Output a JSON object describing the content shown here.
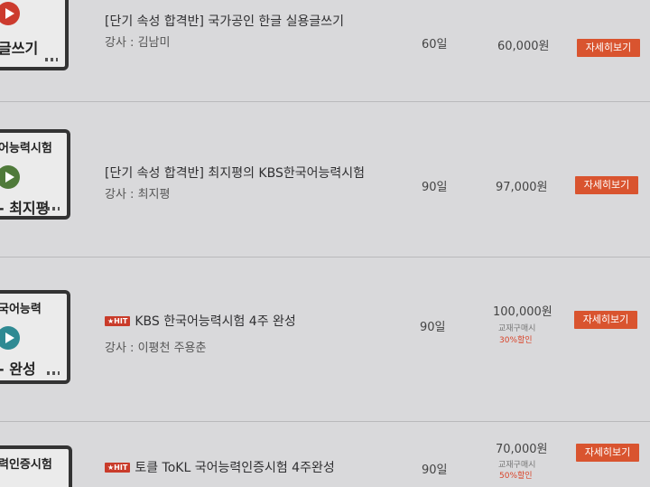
{
  "courses": [
    {
      "thumb_text_bottom": "글쓰기",
      "title": "[단기 속성 합격반] 국가공인 한글 실용글쓰기",
      "teacher": "강사 : 김남미",
      "days": "60일",
      "price": "60,000원",
      "detail_label": "자세히보기"
    },
    {
      "thumb_text_top": "어능력시험",
      "thumb_text_bottom": "- 최지평",
      "title": "[단기 속성 합격반] 최지평의 KBS한국어능력시험",
      "teacher": "강사 : 최지평",
      "days": "90일",
      "price": "97,000원",
      "detail_label": "자세히보기"
    },
    {
      "thumb_text_top": "국어능력",
      "thumb_text_bottom": "- 완성",
      "hit_badge": "★HIT",
      "title": "KBS 한국어능력시험 4주 완성",
      "teacher": "강사 : 이평천 주용춘",
      "days": "90일",
      "price": "100,000원",
      "note": "교재구매시",
      "discount": "30%할인",
      "detail_label": "자세히보기"
    },
    {
      "thumb_text_top": "력인증시험",
      "hit_badge": "★HIT",
      "title": "토클 ToKL 국어능력인증시험 4주완성",
      "days": "90일",
      "price": "70,000원",
      "note": "교재구매시",
      "discount": "50%할인",
      "detail_label": "자세히보기"
    }
  ],
  "colors": {
    "accent": "#d9542f",
    "play_icon": "#cc3b2e",
    "play_icon_green": "#4f7a3a",
    "play_icon_teal": "#2f8a93",
    "background": "#d9d9db"
  }
}
